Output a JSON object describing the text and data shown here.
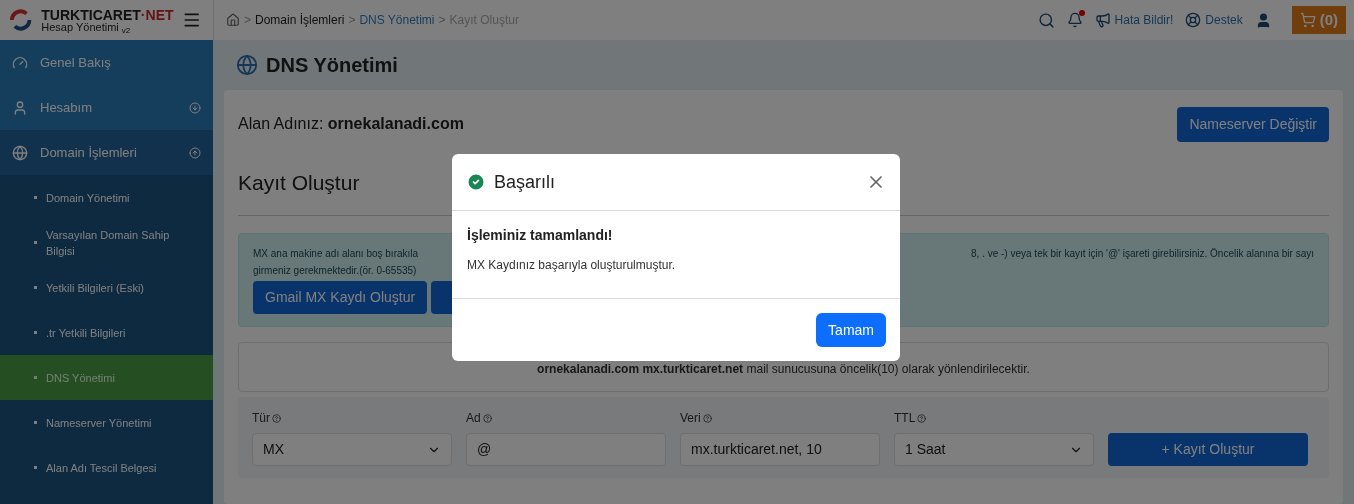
{
  "brand": {
    "name_left": "TURKTICARET",
    "name_dot": "·",
    "name_right": "NET",
    "subtitle": "Hesap Yönetimi",
    "version": "v2"
  },
  "breadcrumb": [
    {
      "label": "Domain İşlemleri",
      "kind": "link"
    },
    {
      "label": "DNS Yönetimi",
      "kind": "current"
    },
    {
      "label": "Kayıt Oluştur",
      "kind": "muted"
    }
  ],
  "breadcrumb_separator": ">",
  "topbar": {
    "notification_dot": true,
    "report_label": "Hata Bildir!",
    "support_label": "Destek",
    "cart_label": "(0)"
  },
  "sidebar": {
    "items": [
      {
        "label": "Genel Bakış",
        "expandable": false,
        "expanded": false
      },
      {
        "label": "Hesabım",
        "expandable": true,
        "expanded": false
      },
      {
        "label": "Domain İşlemleri",
        "expandable": true,
        "expanded": true,
        "children": [
          {
            "label": "Domain Yönetimi",
            "selected": false
          },
          {
            "label": "Varsayılan Domain Sahip Bilgisi",
            "selected": false
          },
          {
            "label": "Yetkili Bilgileri (Eski)",
            "selected": false
          },
          {
            "label": ".tr Yetkili Bilgileri",
            "selected": false
          },
          {
            "label": "DNS Yönetimi",
            "selected": true
          },
          {
            "label": "Nameserver Yönetimi",
            "selected": false
          },
          {
            "label": "Alan Adı Tescil Belgesi",
            "selected": false
          }
        ]
      }
    ]
  },
  "page_title": "DNS Yönetimi",
  "domain": {
    "label": "Alan Adınız:",
    "value": "ornekalanadi.com"
  },
  "nameserver_button": "Nameserver Değiştir",
  "section_title": "Kayıt Oluştur",
  "info": {
    "line_1_left": "MX ana makine adı alanı boş bırakıla",
    "line_1_right": "8, . ve -) veya tek bir kayıt için '@' işareti girebilirsiniz. Öncelik alanına bir sayı",
    "line_2": "girmeniz gerekmektedir.(ör. 0-65535)",
    "buttons": [
      "Gmail MX Kaydı Oluştur"
    ]
  },
  "notice": "**ornekalanadi.com mx.turkticaret.net** mail sunucusuna öncelik(10) olarak yönlendirilecektir.",
  "form": {
    "fields": [
      {
        "label": "Tür",
        "kind": "select",
        "value": "MX"
      },
      {
        "label": "Ad",
        "kind": "input",
        "value": "@"
      },
      {
        "label": "Veri",
        "kind": "input",
        "value": "mx.turkticaret.net, 10"
      },
      {
        "label": "TTL",
        "kind": "select",
        "value": "1 Saat"
      }
    ],
    "submit": "+ Kayıt Oluştur"
  },
  "modal": {
    "title": "Başarılı",
    "heading": "İşleminiz tamamlandı!",
    "message": "MX Kaydınız başarıyla oluşturulmuştur.",
    "button": "Tamam"
  }
}
